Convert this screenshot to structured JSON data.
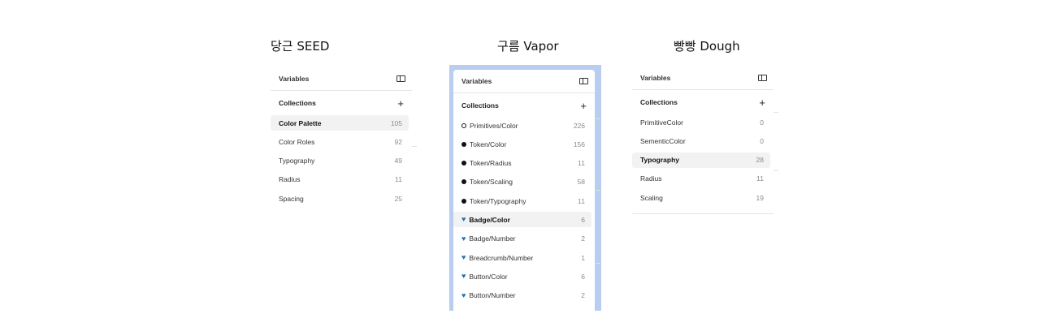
{
  "titles": {
    "seed": "당근 SEED",
    "vapor": "구름 Vapor",
    "dough": "빵빵 Dough"
  },
  "panels": {
    "seed": {
      "header": "Variables",
      "collections_label": "Collections",
      "items": [
        {
          "label": "Color Palette",
          "count": "105",
          "selected": true
        },
        {
          "label": "Color Roles",
          "count": "92"
        },
        {
          "label": "Typography",
          "count": "49"
        },
        {
          "label": "Radius",
          "count": "11"
        },
        {
          "label": "Spacing",
          "count": "25"
        }
      ]
    },
    "vapor": {
      "header": "Variables",
      "collections_label": "Collections",
      "items": [
        {
          "label": "Primitives/Color",
          "count": "226",
          "icon": "circle-outline"
        },
        {
          "label": "Token/Color",
          "count": "156",
          "icon": "circle-filled"
        },
        {
          "label": "Token/Radius",
          "count": "11",
          "icon": "circle-filled"
        },
        {
          "label": "Token/Scaling",
          "count": "58",
          "icon": "circle-filled"
        },
        {
          "label": "Token/Typography",
          "count": "11",
          "icon": "circle-filled"
        },
        {
          "label": "Badge/Color",
          "count": "6",
          "icon": "blue-heart",
          "selected": true
        },
        {
          "label": "Badge/Number",
          "count": "2",
          "icon": "blue-heart"
        },
        {
          "label": "Breadcrumb/Number",
          "count": "1",
          "icon": "blue-heart"
        },
        {
          "label": "Button/Color",
          "count": "6",
          "icon": "blue-heart"
        },
        {
          "label": "Button/Number",
          "count": "2",
          "icon": "blue-heart"
        }
      ]
    },
    "dough": {
      "header": "Variables",
      "collections_label": "Collections",
      "items": [
        {
          "label": "PrimitiveColor",
          "count": "0"
        },
        {
          "label": "SementicColor",
          "count": "0"
        },
        {
          "label": "Typography",
          "count": "28",
          "selected": true
        },
        {
          "label": "Radius",
          "count": "11"
        },
        {
          "label": "Scaling",
          "count": "19"
        }
      ]
    }
  },
  "colors": {
    "vapor_backdrop": "#b8cdf0",
    "heart": "#1a73b8",
    "selected_row": "#f2f2f2"
  }
}
